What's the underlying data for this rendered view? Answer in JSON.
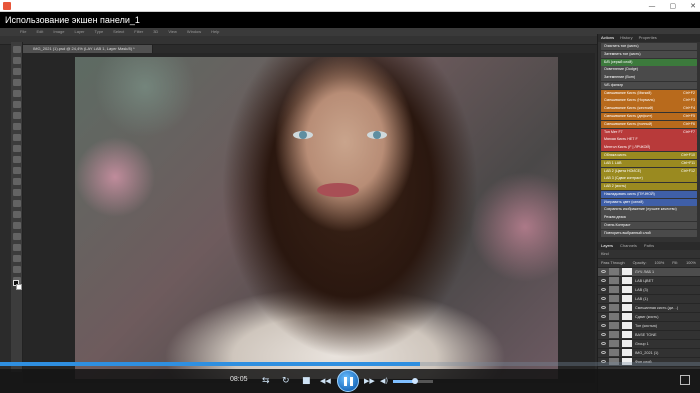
{
  "window": {
    "title": "Использование экшен панели_1",
    "controls": [
      "—",
      "▢",
      "✕"
    ]
  },
  "photoshop": {
    "menu": [
      "File",
      "Edit",
      "Image",
      "Layer",
      "Type",
      "Select",
      "Filter",
      "3D",
      "View",
      "Window",
      "Help"
    ],
    "document_tab": "IMG_2021 (1).psd @ 24,4% (LAY LAB 1, Layer Mask/8) *",
    "panel_tabs": [
      "Actions",
      "History",
      "Properties"
    ],
    "actions": [
      {
        "label": "Очистить тон (кисть)",
        "key": "",
        "color": "#4a4a4a"
      },
      {
        "label": "Затемнить тон (кисть)",
        "key": "",
        "color": "#4a4a4a"
      },
      {
        "label": "Б/В (серый слой)",
        "key": "",
        "color": "#3c7a3c"
      },
      {
        "label": "Осветление (Dodge)",
        "key": "",
        "color": "#4a4a4a"
      },
      {
        "label": "Затемнение (Burn)",
        "key": "",
        "color": "#4a4a4a"
      },
      {
        "label": "Ч/Б фильтр",
        "key": "",
        "color": "#4a4a4a"
      },
      {
        "label": "Смешивание Кисть (Мягкий)",
        "key": "Ctrl+F2",
        "color": "#b86a1c"
      },
      {
        "label": "Смешивание Кисть (Нормаль)",
        "key": "Ctrl+F3",
        "color": "#b86a1c"
      },
      {
        "label": "Смешивание Кисть (жесткий)",
        "key": "Ctrl+F4",
        "color": "#b86a1c"
      },
      {
        "label": "Смешивание Кисть (дефолт)",
        "key": "Ctrl+F5",
        "color": "#b86a1c"
      },
      {
        "label": "Смешивание Кисть (полный)",
        "key": "Ctrl+F6",
        "color": "#b86a1c"
      },
      {
        "label": "Тон Мет F7",
        "key": "Ctrl+F7",
        "color": "#b83a3a"
      },
      {
        "label": "Мягкая Кисть НЕТ F",
        "key": "",
        "color": "#b83a3a"
      },
      {
        "label": "Ментол Кисть (F | ЛРЧКОЙ)",
        "key": "",
        "color": "#b83a3a"
      },
      {
        "label": "Облака кисть",
        "key": "Ctrl+F10",
        "color": "#9a8a20"
      },
      {
        "label": "LAB 1 LAB",
        "key": "Ctrl+F11",
        "color": "#9a8a20"
      },
      {
        "label": "LAB 2 (Цвета НОИСЕ)",
        "key": "Ctrl+F12",
        "color": "#9a8a20"
      },
      {
        "label": "LAB 3 (Сдвиг контраст)",
        "key": "",
        "color": "#9a8a20"
      },
      {
        "label": "LAB 2 (кисть)",
        "key": "",
        "color": "#9a8a20"
      },
      {
        "label": "Накладывать кисть (ПУЧНОЙ)",
        "key": "",
        "color": "#3f5fa8"
      },
      {
        "label": "Исправить цвет (синий)",
        "key": "",
        "color": "#3f5fa8"
      },
      {
        "label": "Сохранить изображение (лучшее качество)",
        "key": "",
        "color": "#4a4a4a"
      },
      {
        "label": "Резкая дезка",
        "key": "",
        "color": "#4a4a4a"
      },
      {
        "label": "Очень Контраст",
        "key": "",
        "color": "#4a4a4a"
      },
      {
        "label": "Повторить выбранный слой",
        "key": "",
        "color": "#4a4a4a"
      }
    ],
    "layers_tabs": [
      "Layers",
      "Channels",
      "Paths"
    ],
    "layers_filter": {
      "kind": "Kind",
      "blend": "Pass Through",
      "opacity_label": "Opacity:",
      "opacity": "100%",
      "fill_label": "Fill:",
      "fill": "100%"
    },
    "layers": [
      {
        "name": "ЛУЧ ЛАБ 1"
      },
      {
        "name": "LAB ЦВЕТ"
      },
      {
        "name": "LAB (3)"
      },
      {
        "name": "LAB (1)"
      },
      {
        "name": "Смешанная кисть (ди…)"
      },
      {
        "name": "Сдвиг (кисть)"
      },
      {
        "name": "Тон (кистью)"
      },
      {
        "name": "BASE TONE"
      },
      {
        "name": "Group 1"
      },
      {
        "name": "IMG_2021 (1)"
      },
      {
        "name": "Фон слой"
      }
    ]
  },
  "player": {
    "time": "08:05",
    "progress": 0.6,
    "volume": 0.55,
    "buttons": {
      "shuffle": "⇆",
      "repeat": "↻",
      "stop": "■",
      "prev": "◀◀",
      "next": "▶▶",
      "volume": "◀)"
    }
  },
  "colors": {
    "accent": "#2f8fe0",
    "panel": "#323232",
    "workspace": "#262626"
  }
}
